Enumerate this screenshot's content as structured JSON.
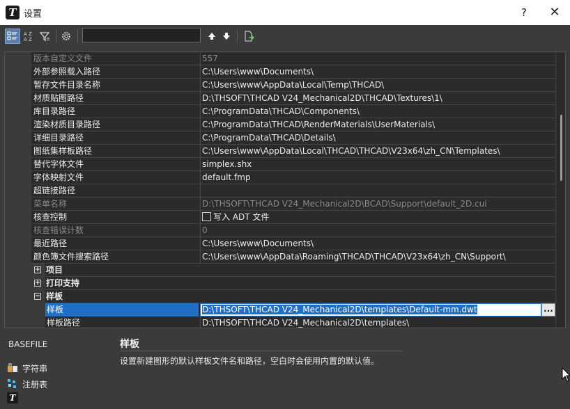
{
  "window": {
    "title": "设置",
    "help": "?",
    "close": "✕",
    "logo": "T"
  },
  "toolbar": {
    "search_value": "",
    "search_placeholder": ""
  },
  "rows": [
    {
      "name": "版本自定义文件",
      "value": "557",
      "disabled": true
    },
    {
      "name": "外部参照载入路径",
      "value": "C:\\Users\\www\\Documents\\"
    },
    {
      "name": "暂存文件目录名称",
      "value": "C:\\Users\\www\\AppData\\Local\\Temp\\THCAD\\"
    },
    {
      "name": "材质贴图路径",
      "value": "D:\\THSOFT\\THCAD V24_Mechanical2D\\THCAD\\Textures\\1\\"
    },
    {
      "name": "库目录路径",
      "value": "C:\\ProgramData\\THCAD\\Components\\"
    },
    {
      "name": "渲染材质目录路径",
      "value": "C:\\ProgramData\\THCAD\\RenderMaterials\\UserMaterials\\"
    },
    {
      "name": "详细目录路径",
      "value": "C:\\ProgramData\\THCAD\\Details\\"
    },
    {
      "name": "图纸集样板路径",
      "value": "C:\\Users\\www\\AppData\\Local\\THCAD\\THCAD\\V23x64\\zh_CN\\Templates\\"
    },
    {
      "name": "替代字体文件",
      "value": "simplex.shx"
    },
    {
      "name": "字体映射文件",
      "value": "default.fmp"
    },
    {
      "name": "超链接路径",
      "value": ""
    },
    {
      "name": "菜单名称",
      "value": "D:\\THSOFT\\THCAD V24_Mechanical2D\\BCAD\\Support\\default_2D.cui",
      "disabled": true
    },
    {
      "name": "核查控制",
      "value": "写入 ADT 文件",
      "checkbox": true
    },
    {
      "name": "核查错误计数",
      "value": "0",
      "disabled": true
    },
    {
      "name": "最近路径",
      "value": "C:\\Users\\www\\Documents\\"
    },
    {
      "name": "颜色簿文件搜索路径",
      "value": "C:\\Users\\www\\AppData\\Roaming\\THCAD\\THCAD\\V23x64\\zh_CN\\Support\\"
    }
  ],
  "categories": [
    {
      "name": "项目",
      "expander": "+"
    },
    {
      "name": "打印支持",
      "expander": "+"
    },
    {
      "name": "样板",
      "expander": "−"
    }
  ],
  "sub_rows": [
    {
      "name": "样板",
      "value": "D:\\THSOFT\\THCAD V24_Mechanical2D\\templates\\Default-mm.dwt",
      "selected": true
    },
    {
      "name": "样板路径",
      "value": "D:\\THSOFT\\THCAD V24_Mechanical2D\\templates\\"
    }
  ],
  "ellipsis_label": "...",
  "description": {
    "property": "BASEFILE",
    "title": "样板",
    "text": "设置新建图形的默认样板文件名和路径，空白时会使用内置的默认值。"
  },
  "bottom_list": [
    {
      "label": "字符串",
      "icon": "string-icon"
    },
    {
      "label": "注册表",
      "icon": "registry-icon"
    }
  ],
  "colors": {
    "background": "#3b3b3b",
    "grid": "#2b2b2b",
    "selection": "#1f6fc4"
  }
}
